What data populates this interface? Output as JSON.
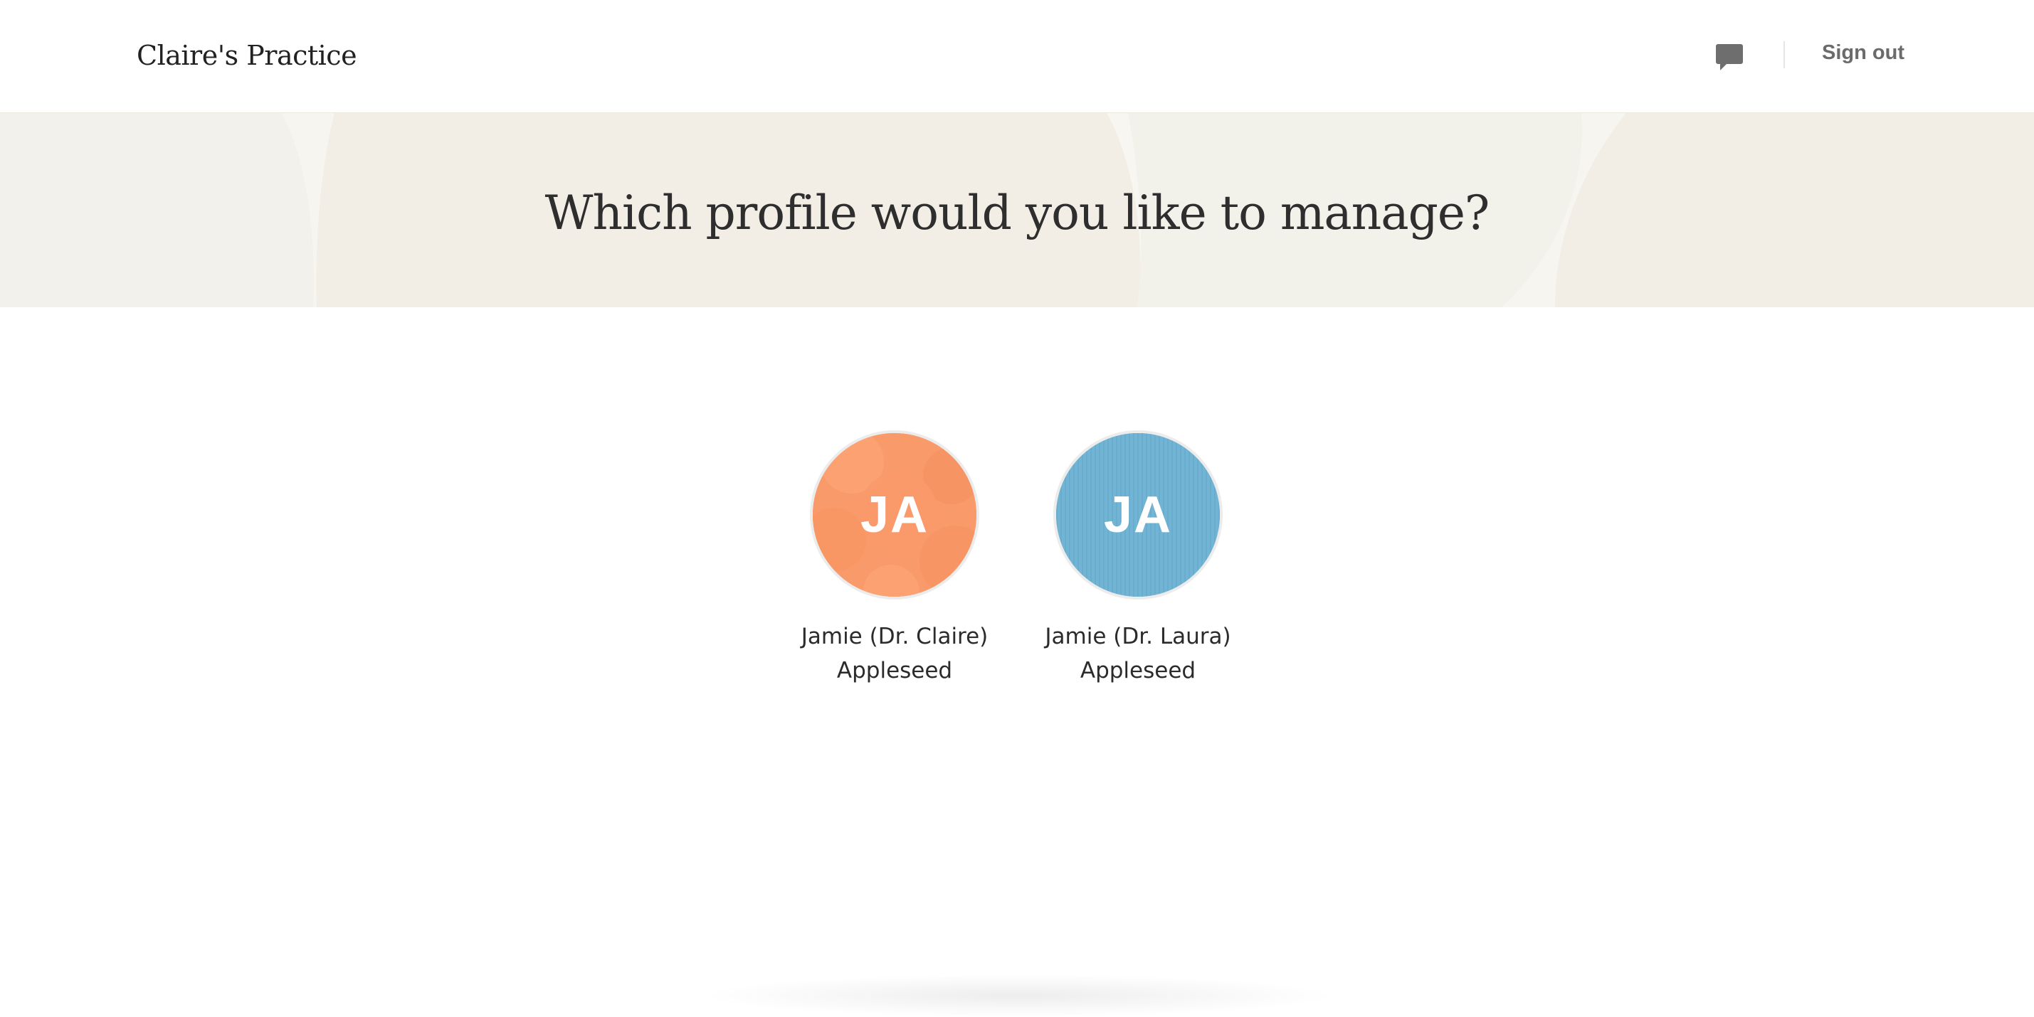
{
  "header": {
    "brand": "Claire's Practice",
    "chat_icon": "chat-bubble-icon",
    "sign_out_label": "Sign out"
  },
  "banner": {
    "title": "Which profile would you like to manage?"
  },
  "profiles": [
    {
      "initials": "JA",
      "name_line1": "Jamie (Dr. Claire)",
      "name_line2": "Appleseed",
      "color": "#f99a6b"
    },
    {
      "initials": "JA",
      "name_line1": "Jamie (Dr. Laura)",
      "name_line2": "Appleseed",
      "color": "#72b4d4"
    }
  ],
  "colors": {
    "banner_bg": "#f3f1ea",
    "text": "#2b2b2b",
    "muted": "#6b6b6b"
  }
}
